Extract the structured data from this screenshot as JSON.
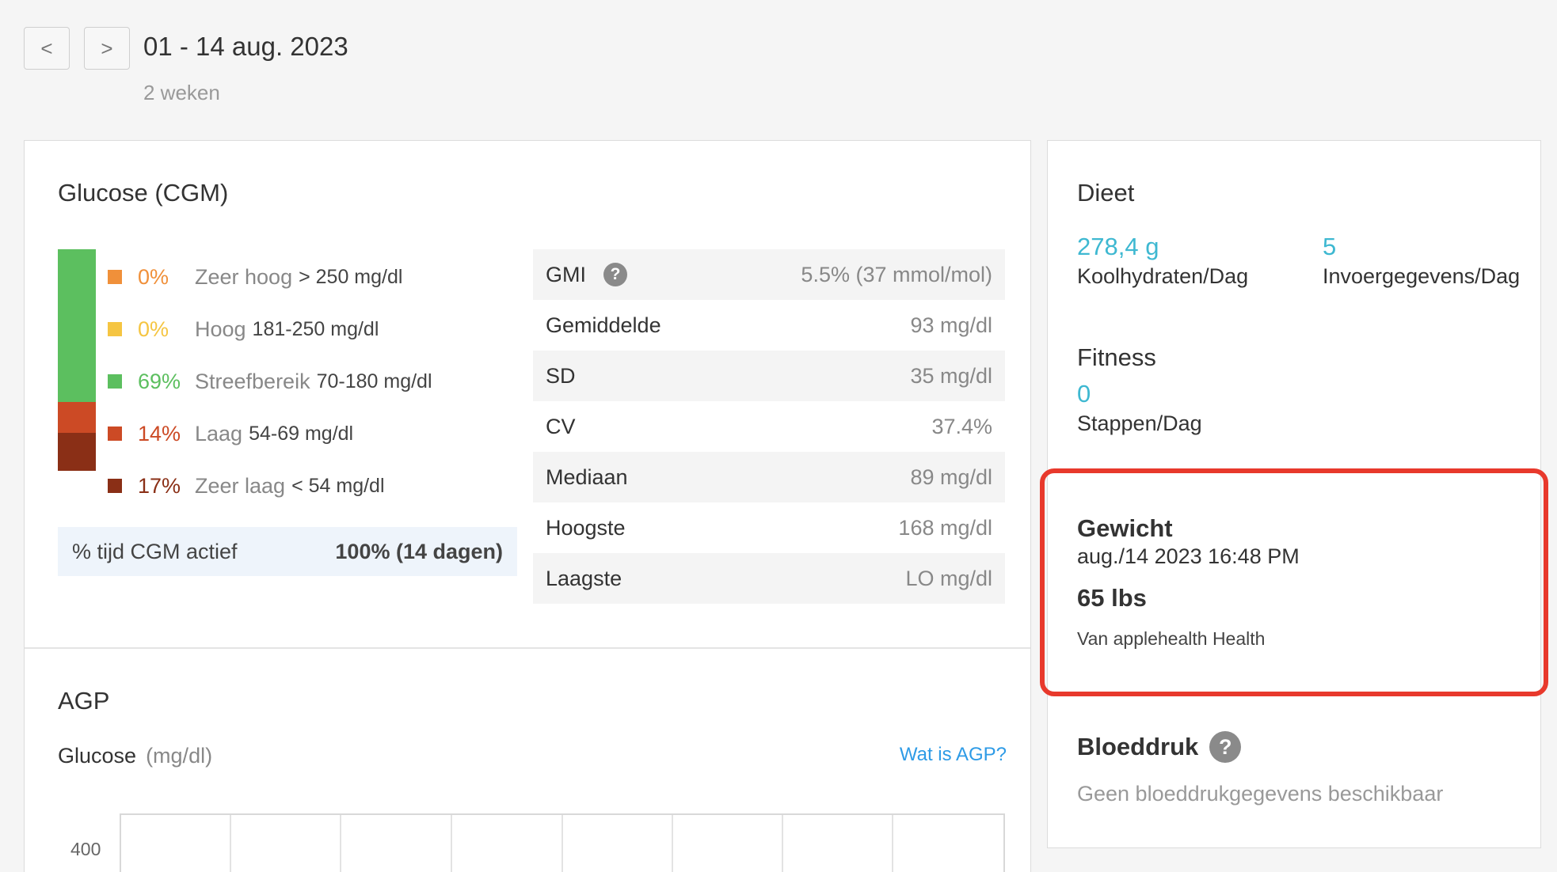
{
  "header": {
    "prev_label": "<",
    "next_label": ">",
    "date_range": "01 - 14 aug. 2023",
    "period": "2 weken"
  },
  "glucose": {
    "title": "Glucose (CGM)",
    "ranges": [
      {
        "pct": "0%",
        "name": "Zeer hoog",
        "range": "> 250 mg/dl",
        "color": "#f0903a",
        "fraction": 0.0
      },
      {
        "pct": "0%",
        "name": "Hoog",
        "range": "181-250 mg/dl",
        "color": "#f5c542",
        "fraction": 0.0
      },
      {
        "pct": "69%",
        "name": "Streefbereik",
        "range": "70-180 mg/dl",
        "color": "#5cbf5f",
        "fraction": 0.69
      },
      {
        "pct": "14%",
        "name": "Laag",
        "range": "54-69 mg/dl",
        "color": "#cc4a25",
        "fraction": 0.14
      },
      {
        "pct": "17%",
        "name": "Zeer laag",
        "range": "< 54 mg/dl",
        "color": "#8a2f16",
        "fraction": 0.17
      }
    ],
    "cgm_active": {
      "label": "% tijd CGM actief",
      "value": "100% (14 dagen)"
    },
    "stats": [
      {
        "label": "GMI",
        "value": "5.5% (37 mmol/mol)",
        "help": "?"
      },
      {
        "label": "Gemiddelde",
        "value": "93 mg/dl"
      },
      {
        "label": "SD",
        "value": "35 mg/dl"
      },
      {
        "label": "CV",
        "value": "37.4%"
      },
      {
        "label": "Mediaan",
        "value": "89 mg/dl"
      },
      {
        "label": "Hoogste",
        "value": "168 mg/dl"
      },
      {
        "label": "Laagste",
        "value": "LO mg/dl"
      }
    ]
  },
  "agp": {
    "title": "AGP",
    "subtitle": "Glucose",
    "unit": "(mg/dl)",
    "link": "Wat is AGP?",
    "y_tick": "400"
  },
  "side": {
    "diet": {
      "title": "Dieet",
      "carbs_value": "278,4 g",
      "carbs_label": "Koolhydraten/Dag",
      "entries_value": "5",
      "entries_label": "Invoergegevens/Dag"
    },
    "fitness": {
      "title": "Fitness",
      "steps_value": "0",
      "steps_label": "Stappen/Dag"
    },
    "weight": {
      "title": "Gewicht",
      "date": "aug./14 2023 16:48 PM",
      "value": "65 lbs",
      "source": "Van applehealth Health"
    },
    "bp": {
      "title": "Bloeddruk",
      "help": "?",
      "empty": "Geen bloeddrukgegevens beschikbaar"
    }
  },
  "colors": {
    "accent": "#3eb8d1",
    "link": "#2e9be6",
    "highlight": "#e8392c"
  }
}
